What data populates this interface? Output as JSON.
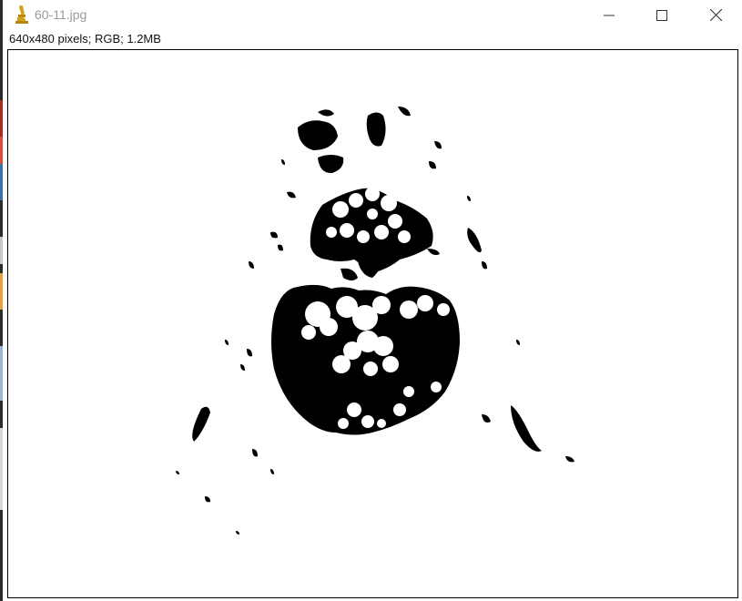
{
  "window": {
    "title": "60-11.jpg",
    "app_icon": "microscope-icon",
    "controls": {
      "minimize_icon": "minimize-icon",
      "maximize_icon": "maximize-icon",
      "close_icon": "close-icon"
    }
  },
  "image_info": "640x480 pixels; RGB; 1.2MB",
  "image": {
    "description_icon": "thresholded-binary-ct-slice",
    "foreground_color": "#000000",
    "background_color": "#ffffff"
  },
  "colors": {
    "title_text": "#9a9a9a",
    "icon_accent": "#d4a017"
  }
}
